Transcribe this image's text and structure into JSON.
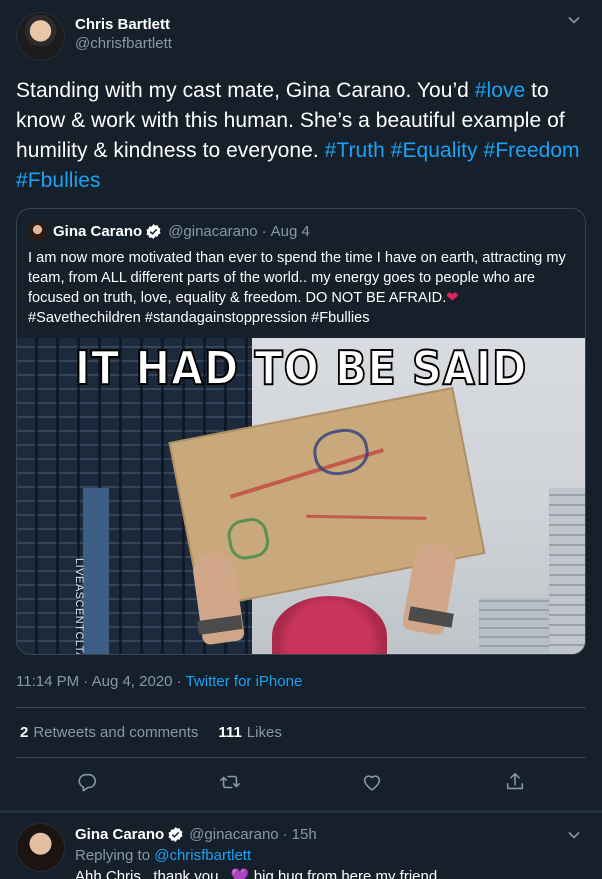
{
  "tweet": {
    "author": {
      "name": "Chris Bartlett",
      "handle": "@chrisfbartlett"
    },
    "text_parts": {
      "p1": "Standing with my cast mate, Gina Carano. You’d ",
      "h1": "#love",
      "p2": " to know & work with this human. She’s a beautiful example of humility & kindness to everyone. ",
      "h2": "#Truth",
      "h3": "#Equality",
      "h4": "#Freedom",
      "h5": "#Fbullies"
    },
    "quote": {
      "name": "Gina Carano",
      "handle": "@ginacarano",
      "dot": "·",
      "date": "Aug 4",
      "text": "I am now more motivated than ever to spend the time I have on earth, attracting my team, from ALL different parts of the world.. my energy goes to people who are focused on truth, love, equality & freedom. DO NOT BE AFRAID.",
      "heart": "❤",
      "hashtags": "#Savethechildren #standagainstoppression #Fbullies",
      "image": {
        "meme_text": "IT HAD TO BE SAID",
        "building_text": "LIVEASCENTCLTA"
      }
    },
    "timestamp": {
      "time": "11:14 PM · Aug 4, 2020 · ",
      "source": "Twitter for iPhone"
    },
    "stats": {
      "retweets_count": "2",
      "retweets_label": "Retweets and comments",
      "likes_count": "111",
      "likes_label": "Likes"
    }
  },
  "reply": {
    "name": "Gina Carano",
    "handle": "@ginacarano",
    "dot": "·",
    "time": "15h",
    "replying_label": "Replying to ",
    "replying_to": "@chrisfbartlett",
    "text_before": "Ahh Chris.. thank you.. ",
    "emoji": "💜",
    "text_after": " big hug from here my friend."
  },
  "colors": {
    "background": "#15202b",
    "accent": "#1da1f2",
    "secondary_text": "#8899a6",
    "border": "#38444d"
  },
  "icons": [
    "chevron-down-icon",
    "verified-badge-icon",
    "reply-icon",
    "retweet-icon",
    "like-icon",
    "share-icon"
  ]
}
